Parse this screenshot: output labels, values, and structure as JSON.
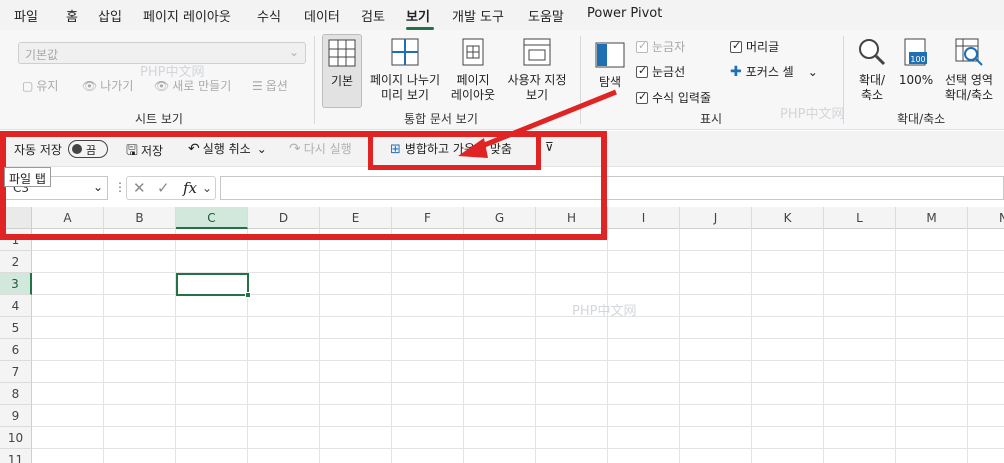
{
  "tabs": [
    "파일",
    "홈",
    "삽입",
    "페이지 레이아웃",
    "수식",
    "데이터",
    "검토",
    "보기",
    "개발 도구",
    "도움말",
    "Power Pivot"
  ],
  "active_tab": "보기",
  "sheet_view": {
    "select_value": "기본값",
    "keep": "유지",
    "exit": "나가기",
    "new": "새로 만들기",
    "options": "옵션",
    "group_label": "시트 보기"
  },
  "workbook_views": {
    "normal": "기본",
    "page_break": "페이지 나누기\n미리 보기",
    "page_layout": "페이지\n레이아웃",
    "custom": "사용자 지정\n보기",
    "group_label": "통합 문서 보기"
  },
  "show": {
    "navigation": "탐색",
    "ruler": "눈금자",
    "gridlines": "눈금선",
    "formula_bar": "수식 입력줄",
    "headings": "머리글",
    "focus_cell": "포커스 셀",
    "group_label": "표시"
  },
  "zoom": {
    "zoom": "확대/\n축소",
    "zoom_100": "100%",
    "zoom_selection": "선택 영역\n확대/축소",
    "group_label": "확대/축소",
    "icon_number": "100"
  },
  "qat": {
    "autosave": "자동 저장",
    "toggle_state": "끔",
    "save": "저장",
    "undo": "실행 취소",
    "redo": "다시 실행",
    "merge_center": "병합하고 가운데 맞춤"
  },
  "tooltip": "파일 탭",
  "name_box": "C3",
  "fx_label": "fx",
  "columns": [
    "A",
    "B",
    "C",
    "D",
    "E",
    "F",
    "G",
    "H",
    "I",
    "J",
    "K",
    "L",
    "M",
    "N"
  ],
  "rows": [
    "1",
    "2",
    "3",
    "4",
    "5",
    "6",
    "7",
    "8",
    "9",
    "10",
    "11"
  ],
  "selected_cell": "C3",
  "watermark": "PHP中文网",
  "colors": {
    "accent": "#217346",
    "annotation": "#e02424"
  }
}
